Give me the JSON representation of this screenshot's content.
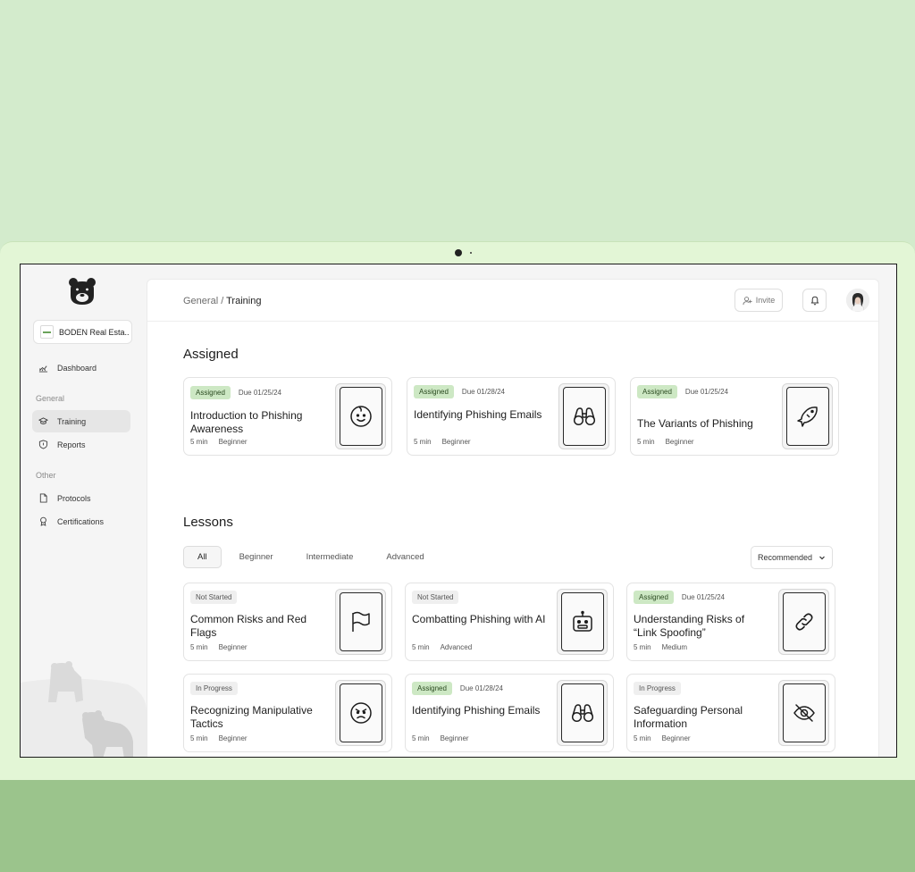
{
  "app": {
    "org_name": "BODEN Real Esta...",
    "breadcrumb_parent": "General",
    "breadcrumb_separator": "/",
    "breadcrumb_current": "Training",
    "invite_label": "Invite"
  },
  "sidebar": {
    "dashboard": "Dashboard",
    "group_general": "General",
    "training": "Training",
    "reports": "Reports",
    "group_other": "Other",
    "protocols": "Protocols",
    "certifications": "Certifications"
  },
  "assigned": {
    "title": "Assigned",
    "cards": [
      {
        "badge": "Assigned",
        "due": "Due 01/25/24",
        "title": "Introduction to Phishing Awareness",
        "duration": "5 min",
        "level": "Beginner",
        "icon": "baby-face-icon"
      },
      {
        "badge": "Assigned",
        "due": "Due 01/28/24",
        "title": "Identifying Phishing Emails",
        "duration": "5 min",
        "level": "Beginner",
        "icon": "binoculars-icon"
      },
      {
        "badge": "Assigned",
        "due": "Due 01/25/24",
        "title": "The Variants of Phishing",
        "duration": "5 min",
        "level": "Beginner",
        "icon": "fish-icon"
      }
    ]
  },
  "lessons": {
    "title": "Lessons",
    "filters": [
      "All",
      "Beginner",
      "Intermediate",
      "Advanced"
    ],
    "sort": "Recommended",
    "cards": [
      {
        "badge": "Not Started",
        "due": "",
        "title": "Common Risks and Red Flags",
        "duration": "5 min",
        "level": "Beginner",
        "icon": "flag-icon"
      },
      {
        "badge": "Not Started",
        "due": "",
        "title": "Combatting Phishing with AI",
        "duration": "5 min",
        "level": "Advanced",
        "icon": "robot-icon"
      },
      {
        "badge": "Assigned",
        "due": "Due 01/25/24",
        "title": "Understanding Risks of “Link Spoofing”",
        "duration": "5 min",
        "level": "Medium",
        "icon": "link-icon"
      },
      {
        "badge": "In Progress",
        "due": "",
        "title": "Recognizing Manipulative Tactics",
        "duration": "5 min",
        "level": "Beginner",
        "icon": "angry-face-icon"
      },
      {
        "badge": "Assigned",
        "due": "Due 01/28/24",
        "title": "Identifying Phishing Emails",
        "duration": "5 min",
        "level": "Beginner",
        "icon": "binoculars-icon"
      },
      {
        "badge": "In Progress",
        "due": "",
        "title": "Safeguarding Personal Information",
        "duration": "5 min",
        "level": "Beginner",
        "icon": "eye-off-icon"
      }
    ]
  }
}
